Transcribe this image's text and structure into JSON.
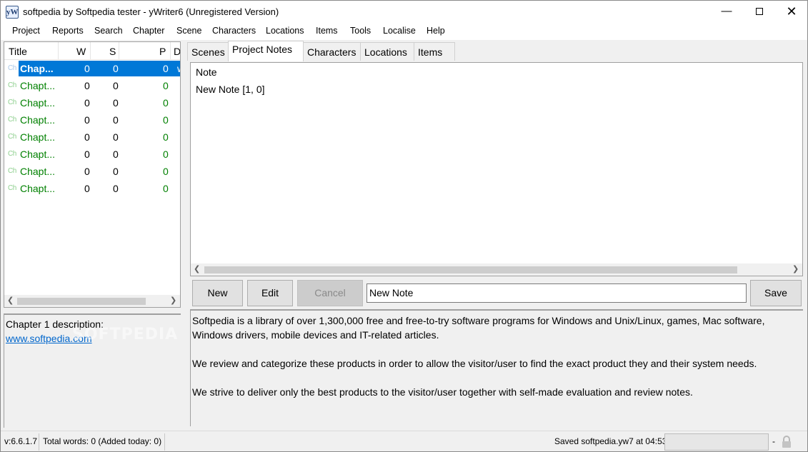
{
  "window": {
    "title": "softpedia by Softpedia tester - yWriter6 (Unregistered Version)",
    "app_icon": "yW"
  },
  "menu": [
    "Project",
    "Reports",
    "Search",
    "Chapter",
    "Scene",
    "Characters",
    "Locations",
    "Items",
    "Tools",
    "Localise",
    "Help"
  ],
  "chapter_list": {
    "columns": [
      "Title",
      "W",
      "S",
      "P",
      "D"
    ],
    "rows": [
      {
        "icon": "Ch",
        "title": "Chap...",
        "w": "0",
        "s": "0",
        "p": "0",
        "d": "w",
        "selected": true
      },
      {
        "icon": "Ch",
        "title": "Chapt...",
        "w": "0",
        "s": "0",
        "p": "0"
      },
      {
        "icon": "Ch",
        "title": "Chapt...",
        "w": "0",
        "s": "0",
        "p": "0"
      },
      {
        "icon": "Ch",
        "title": "Chapt...",
        "w": "0",
        "s": "0",
        "p": "0"
      },
      {
        "icon": "Ch",
        "title": "Chapt...",
        "w": "0",
        "s": "0",
        "p": "0"
      },
      {
        "icon": "Ch",
        "title": "Chapt...",
        "w": "0",
        "s": "0",
        "p": "0"
      },
      {
        "icon": "Ch",
        "title": "Chapt...",
        "w": "0",
        "s": "0",
        "p": "0"
      },
      {
        "icon": "Ch",
        "title": "Chapt...",
        "w": "0",
        "s": "0",
        "p": "0"
      }
    ]
  },
  "chapter_description": {
    "label": "Chapter 1 description:",
    "link": "www.softpedia.com"
  },
  "tabs": [
    "Scenes",
    "Project Notes",
    "Characters",
    "Locations",
    "Items"
  ],
  "active_tab": "Project Notes",
  "notes": {
    "header": "Note",
    "items": [
      "New Note [1, 0]"
    ]
  },
  "buttons": {
    "new": "New",
    "edit": "Edit",
    "cancel": "Cancel",
    "save": "Save"
  },
  "note_name_value": "New Note",
  "note_text": [
    "Softpedia is a library of over 1,300,000 free and free-to-try software programs for Windows and Unix/Linux, games, Mac software, Windows drivers, mobile devices and IT-related articles.",
    "We review and categorize these products in order to allow the visitor/user to find the exact product they and their system needs.",
    "We strive to deliver only the best products to the visitor/user together with self-made evaluation and review notes."
  ],
  "watermark": "SOFTPEDIA",
  "status": {
    "version": "v:6.6.1.7",
    "words": "Total words: 0 (Added today: 0)",
    "saved": "Saved softpedia.yw7 at 04:53",
    "dash": "-"
  },
  "icons": {
    "minimize": "minimize-icon",
    "maximize": "maximize-icon",
    "close": "close-icon",
    "lock": "lock-icon"
  },
  "colors": {
    "selection": "#0078d7",
    "chapter_text": "#008000",
    "link": "#0066cc"
  }
}
